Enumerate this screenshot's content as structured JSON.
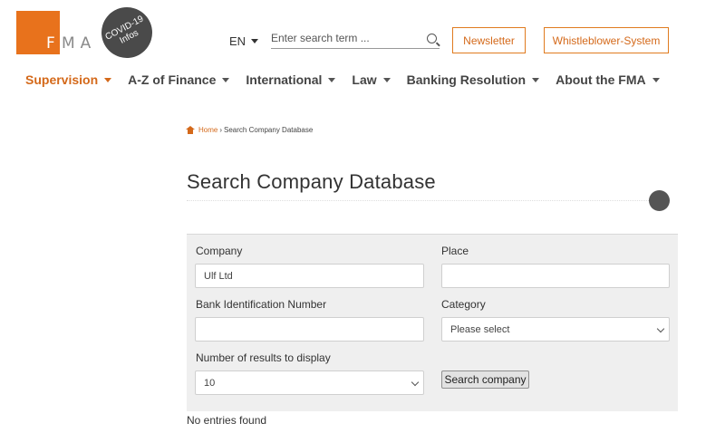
{
  "header": {
    "logo_text": "FMA",
    "logo_letters": [
      "F",
      "M",
      "A"
    ],
    "covid_badge": [
      "COVID-19",
      "Infos"
    ],
    "language": "EN",
    "search_placeholder": "Enter search term ...",
    "newsletter_label": "Newsletter",
    "whistleblower_label": "Whistleblower-System"
  },
  "nav": {
    "items": [
      {
        "label": "Supervision",
        "active": true
      },
      {
        "label": "A-Z of Finance",
        "active": false
      },
      {
        "label": "International",
        "active": false
      },
      {
        "label": "Law",
        "active": false
      },
      {
        "label": "Banking Resolution",
        "active": false
      },
      {
        "label": "About the FMA",
        "active": false
      }
    ]
  },
  "breadcrumb": {
    "home": "Home",
    "separator": "›",
    "current": "Search Company Database"
  },
  "page": {
    "title": "Search Company Database"
  },
  "form": {
    "company_label": "Company",
    "company_value": "Ulf Ltd",
    "place_label": "Place",
    "place_value": "",
    "bin_label": "Bank Identification Number",
    "bin_value": "",
    "category_label": "Category",
    "category_value": "Please select",
    "results_label": "Number of results to display",
    "results_value": "10",
    "submit_label": "Search company"
  },
  "results": {
    "message": "No entries found"
  },
  "colors": {
    "accent": "#e8721c",
    "accent_text": "#d4691a",
    "covid_badge": "#4a4a4a",
    "form_background": "#efefef"
  }
}
